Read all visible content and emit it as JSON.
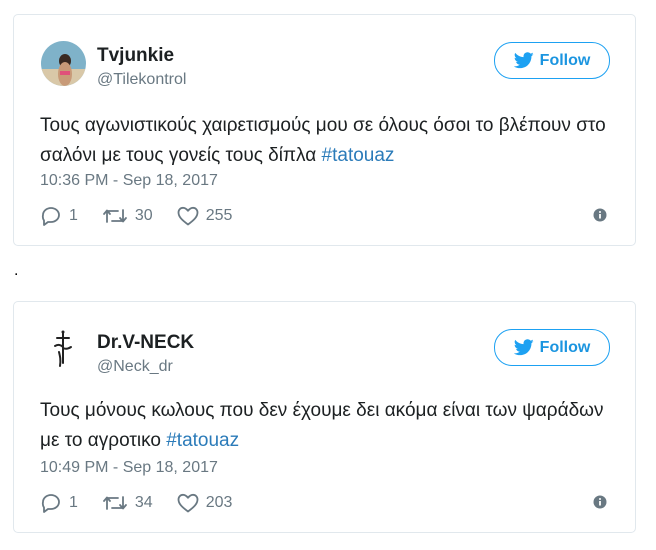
{
  "tweets": [
    {
      "name": "Tvjunkie",
      "handle": "@Tilekontrol",
      "text": "Τους αγωνιστικούς χαιρετισμούς μου σε όλους όσοι το βλέπουν στο σαλόνι με τους γονείς τους δίπλα",
      "hashtag": "#tatouaz",
      "time": "10:36 PM - Sep 18, 2017",
      "replies": "1",
      "retweets": "30",
      "likes": "255",
      "follow_label": "Follow"
    },
    {
      "name": "Dr.V-NECK",
      "handle": "@Neck_dr",
      "text": "Τους μόνους κωλους που δεν έχουμε δει ακόμα είναι των ψαράδων με το αγροτικο",
      "hashtag": "#tatouaz",
      "time": "10:49 PM - Sep 18, 2017",
      "replies": "1",
      "retweets": "34",
      "likes": "203",
      "follow_label": "Follow"
    }
  ],
  "separator": ".",
  "colors": {
    "accent": "#1da1f2",
    "link": "#2b7bb9",
    "muted": "#697882",
    "border": "#e1e8ed"
  }
}
